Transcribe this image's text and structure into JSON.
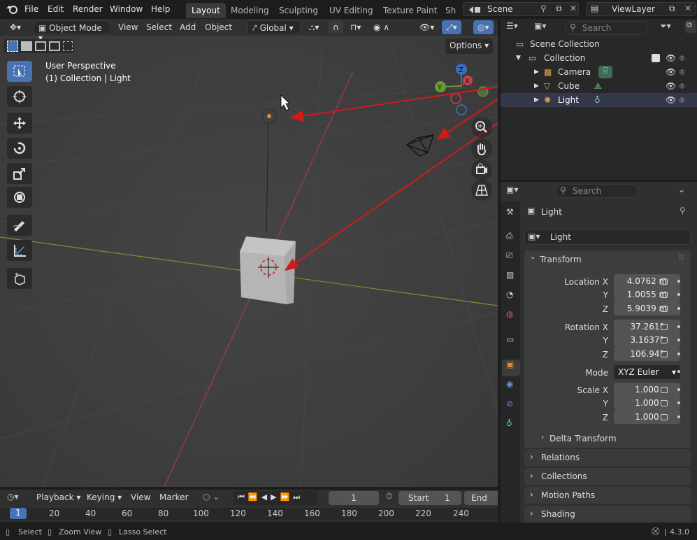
{
  "menu": {
    "file": "File",
    "edit": "Edit",
    "render": "Render",
    "window": "Window",
    "help": "Help"
  },
  "workspaces": [
    "Layout",
    "Modeling",
    "Sculpting",
    "UV Editing",
    "Texture Paint",
    "Sh"
  ],
  "scene": "Scene",
  "view_layer": "ViewLayer",
  "viewport": {
    "mode": "Object Mode",
    "view": "View",
    "select": "Select",
    "add": "Add",
    "object": "Object",
    "orientation": "Global",
    "options": "Options",
    "info_line1": "User Perspective",
    "info_line2": "(1) Collection | Light",
    "gizmo_x": "X",
    "gizmo_y": "Y",
    "gizmo_z": "Z"
  },
  "outliner": {
    "search_placeholder": "Search",
    "scene_collection": "Scene Collection",
    "collection": "Collection",
    "items": [
      "Camera",
      "Cube",
      "Light"
    ]
  },
  "properties": {
    "search_placeholder": "Search",
    "object_name": "Light",
    "data_name": "Light",
    "transform": "Transform",
    "location_label": "Location X",
    "y_label": "Y",
    "z_label": "Z",
    "location": [
      "4.0762 m",
      "1.0055 m",
      "5.9039 m"
    ],
    "rotation_label": "Rotation X",
    "rotation": [
      "37.261°",
      "3.1637°",
      "106.94°"
    ],
    "mode_label": "Mode",
    "mode": "XYZ Euler",
    "scale_label": "Scale X",
    "scale": [
      "1.000",
      "1.000",
      "1.000"
    ],
    "delta": "Delta Transform",
    "sections": [
      "Relations",
      "Collections",
      "Motion Paths",
      "Shading"
    ]
  },
  "timeline": {
    "playback": "Playback",
    "keying": "Keying",
    "view": "View",
    "marker": "Marker",
    "frame": "1",
    "start_label": "Start",
    "start": "1",
    "end_label": "End",
    "ticks": [
      "1",
      "20",
      "40",
      "60",
      "80",
      "100",
      "120",
      "140",
      "160",
      "180",
      "200",
      "220",
      "240"
    ]
  },
  "status": {
    "select": "Select",
    "zoom": "Zoom View",
    "lasso": "Lasso Select",
    "version": "4.3.0"
  },
  "colors": {
    "accent": "#4772b3",
    "arrow": "#d11a1a",
    "x_axis": "#a83a44",
    "y_axis": "#6a9a2f",
    "object_orange": "#e88a2e"
  }
}
